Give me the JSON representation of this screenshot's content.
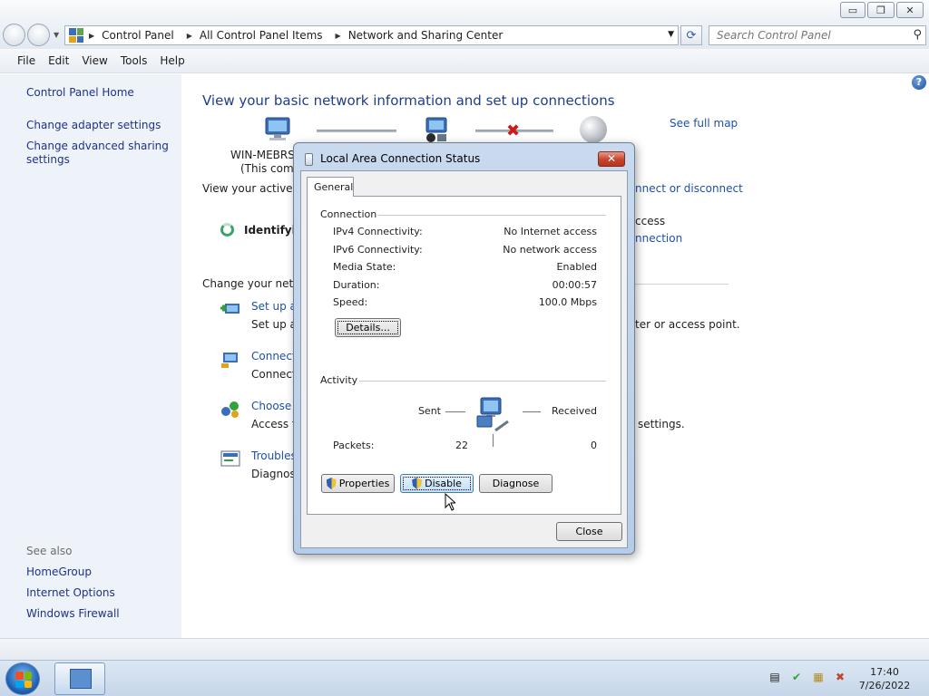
{
  "window": {
    "controls": {
      "minimize": "▭",
      "maximize": "❐",
      "close": "✕"
    }
  },
  "address": {
    "crumbs": [
      "Control Panel",
      "All Control Panel Items",
      "Network and Sharing Center"
    ],
    "search_placeholder": "Search Control Panel",
    "search_icon": "magnifier-icon",
    "refresh_icon": "refresh-icon"
  },
  "menu": [
    "File",
    "Edit",
    "View",
    "Tools",
    "Help"
  ],
  "left_pane": {
    "home": "Control Panel Home",
    "adapter": "Change adapter settings",
    "sharing_line1": "Change advanced sharing",
    "sharing_line2": "settings",
    "see_also": "See also",
    "homegroup": "HomeGroup",
    "internet_options": "Internet Options",
    "firewall": "Windows Firewall"
  },
  "main": {
    "heading": "View your basic network information and set up connections",
    "see_full_map": "See full map",
    "computer_name": "WIN-MEBRSP",
    "computer_sub": "(This comp",
    "active_networks": "View your active ne",
    "connect_disconnect": "nnect or disconnect",
    "identifying": "Identifyin",
    "access_label": "ccess",
    "connection_link": "nnection",
    "change_settings": "Change your netwo",
    "tasks": [
      {
        "title": "Set up a",
        "desc": "Set up a",
        "tail": "ter or access point."
      },
      {
        "title": "Connect",
        "desc": "Connect",
        "tail": ""
      },
      {
        "title": "Choose h",
        "desc": "Access fil",
        "tail": "settings."
      },
      {
        "title": "Troubles",
        "desc": "Diagnose",
        "tail": ""
      }
    ]
  },
  "dialog": {
    "title": "Local Area Connection Status",
    "tab": "General",
    "connection_group": "Connection",
    "rows": [
      {
        "label": "IPv4 Connectivity:",
        "value": "No Internet access"
      },
      {
        "label": "IPv6 Connectivity:",
        "value": "No network access"
      },
      {
        "label": "Media State:",
        "value": "Enabled"
      },
      {
        "label": "Duration:",
        "value": "00:00:57"
      },
      {
        "label": "Speed:",
        "value": "100.0 Mbps"
      }
    ],
    "details_button": "Details...",
    "activity_group": "Activity",
    "sent_label": "Sent",
    "received_label": "Received",
    "packets_label": "Packets:",
    "packets_sent": "22",
    "packets_received": "0",
    "properties_button": "Properties",
    "disable_button": "Disable",
    "diagnose_button": "Diagnose",
    "close_button": "Close"
  },
  "taskbar": {
    "time": "17:40",
    "date": "7/26/2022"
  },
  "colors": {
    "link": "#1e50a8",
    "heading": "#1e3d8f",
    "left_pane_bg": "#eef3fa",
    "close_red": "#c7422b"
  }
}
